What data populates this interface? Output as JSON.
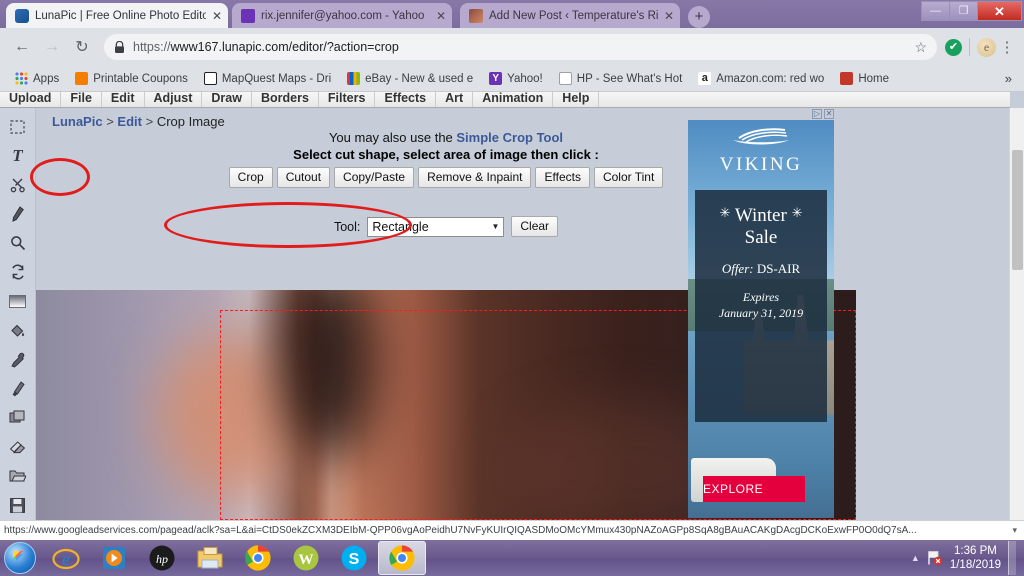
{
  "browser": {
    "tabs": [
      {
        "title": "LunaPic | Free Online Photo Edito",
        "favicon": "lunapic-icon",
        "active": true,
        "close_label": "✕"
      },
      {
        "title": "rix.jennifer@yahoo.com - Yahoo",
        "favicon": "yahoo-mail-icon",
        "active": false,
        "close_label": "✕"
      },
      {
        "title": "Add New Post ‹ Temperature's Ri",
        "favicon": "wordpress-site-icon",
        "active": false,
        "close_label": "✕"
      }
    ],
    "new_tab_label": "+",
    "window_controls": {
      "minimize": "—",
      "maximize": "❐",
      "close": "✕"
    },
    "nav": {
      "back": "←",
      "forward": "→",
      "reload": "↻",
      "lock_icon": "lock-icon",
      "url_scheme": "https://",
      "url_rest": "www167.lunapic.com/editor/?action=crop",
      "star": "☆",
      "extension_check": "✔",
      "avatar_initial": "e",
      "menu": "⋮"
    },
    "bookmarks": [
      {
        "label": "Apps",
        "icon": "apps-grid-icon"
      },
      {
        "label": "Printable Coupons",
        "icon": "blogger-icon"
      },
      {
        "label": "MapQuest Maps - Dri",
        "icon": "mapquest-icon"
      },
      {
        "label": "eBay - New & used e",
        "icon": "ebay-icon"
      },
      {
        "label": "Yahoo!",
        "icon": "yahoo-icon"
      },
      {
        "label": "HP - See What's Hot",
        "icon": "page-icon"
      },
      {
        "label": "Amazon.com: red wo",
        "icon": "amazon-icon"
      },
      {
        "label": "Home",
        "icon": "home-icon"
      }
    ],
    "bookmarks_overflow": "»",
    "status_url": "https://www.googleadservices.com/pagead/aclk?sa=L&ai=CtDS0ekZCXM3DEIbM-QPP06vgAoPeidhU7NvFyKUIrQIQASDMoOMcYMmux430pNAZoAGPp8SqA8gBAuACAKgDAcgDCKoExwFP0O0dQ7sA...",
    "status_caret": "▾"
  },
  "lunapic": {
    "menubar": [
      "Upload",
      "File",
      "Edit",
      "Adjust",
      "Draw",
      "Borders",
      "Filters",
      "Effects",
      "Art",
      "Animation",
      "Help"
    ],
    "breadcrumb": {
      "root": "LunaPic",
      "section": "Edit",
      "page": "Crop Image",
      "separator": ">"
    },
    "hint_prefix": "You may also use the ",
    "hint_link": "Simple Crop Tool",
    "instruction": "Select cut shape, select area of image then click :",
    "shape_buttons": [
      "Crop",
      "Cutout",
      "Copy/Paste",
      "Remove & Inpaint",
      "Effects",
      "Color Tint"
    ],
    "tool_label": "Tool:",
    "tool_value": "Rectangle",
    "tool_arrow": "▼",
    "clear_label": "Clear",
    "toolrail": [
      "selection-icon",
      "text-icon",
      "scissors-icon",
      "pencil-icon",
      "magnifier-icon",
      "rotate-icon",
      "gradient-icon",
      "paint-bucket-icon",
      "eyedropper-icon",
      "brush-icon",
      "layers-icon",
      "eraser-icon",
      "folder-open-icon",
      "save-icon"
    ],
    "annotation_color": "#e21b1b"
  },
  "ad": {
    "controls": {
      "adchoices": "▷",
      "close": "✕"
    },
    "brand": "VIKING",
    "ship_glyph": "⚓",
    "headline_line1": "Winter",
    "headline_line2": "Sale",
    "snowflake": "✳",
    "offer_label": "Offer:",
    "offer_code": "DS-AIR",
    "expires_label": "Expires",
    "expires_date": "January 31, 2019",
    "cta": "EXPLORE",
    "cta_color": "#e4003c"
  },
  "taskbar": {
    "start": "windows-start-orb",
    "items": [
      {
        "icon": "internet-explorer-icon",
        "active": false
      },
      {
        "icon": "media-player-icon",
        "active": false
      },
      {
        "icon": "hp-icon",
        "active": false
      },
      {
        "icon": "file-explorer-icon",
        "active": false
      },
      {
        "icon": "chrome-icon",
        "active": false
      },
      {
        "icon": "w-app-icon",
        "active": false
      },
      {
        "icon": "skype-icon",
        "active": false
      },
      {
        "icon": "chrome-icon",
        "active": true
      }
    ],
    "tray": {
      "overflow_arrow": "▲",
      "action_center": "flag-alert-icon"
    },
    "clock_time": "1:36 PM",
    "clock_date": "1/18/2019"
  }
}
